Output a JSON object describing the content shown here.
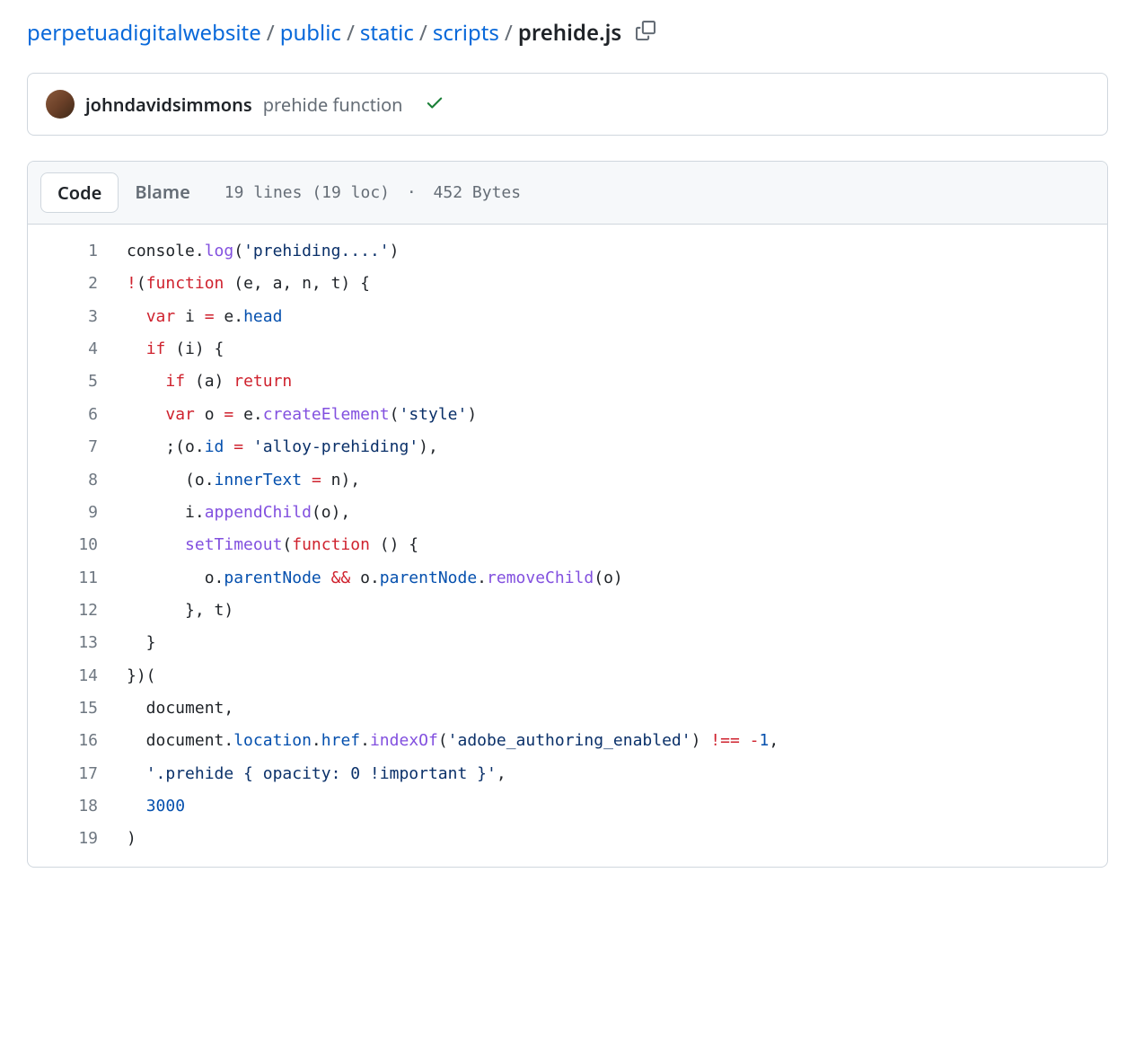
{
  "breadcrumb": {
    "parts": [
      "perpetuadigitalwebsite",
      "public",
      "static",
      "scripts"
    ],
    "current": "prehide.js",
    "sep": "/"
  },
  "commit": {
    "author": "johndavidsimmons",
    "message": "prehide function"
  },
  "tabs": {
    "code": "Code",
    "blame": "Blame"
  },
  "fileinfo": {
    "lines": "19 lines (19 loc)",
    "dot": "·",
    "size": "452 Bytes"
  },
  "line_count": 19,
  "code": {
    "tokens": [
      [
        [
          "plain",
          "console."
        ],
        [
          "fn",
          "log"
        ],
        [
          "plain",
          "("
        ],
        [
          "str",
          "'prehiding....'"
        ],
        [
          "plain",
          ")"
        ]
      ],
      [
        [
          "op",
          "!"
        ],
        [
          "plain",
          "("
        ],
        [
          "kw",
          "function"
        ],
        [
          "plain",
          " (e, a, n, t) {"
        ]
      ],
      [
        [
          "plain",
          "  "
        ],
        [
          "kw",
          "var"
        ],
        [
          "plain",
          " i "
        ],
        [
          "op",
          "="
        ],
        [
          "plain",
          " e."
        ],
        [
          "prop",
          "head"
        ]
      ],
      [
        [
          "plain",
          "  "
        ],
        [
          "kw",
          "if"
        ],
        [
          "plain",
          " (i) {"
        ]
      ],
      [
        [
          "plain",
          "    "
        ],
        [
          "kw",
          "if"
        ],
        [
          "plain",
          " (a) "
        ],
        [
          "kw",
          "return"
        ]
      ],
      [
        [
          "plain",
          "    "
        ],
        [
          "kw",
          "var"
        ],
        [
          "plain",
          " o "
        ],
        [
          "op",
          "="
        ],
        [
          "plain",
          " e."
        ],
        [
          "fn",
          "createElement"
        ],
        [
          "plain",
          "("
        ],
        [
          "str",
          "'style'"
        ],
        [
          "plain",
          ")"
        ]
      ],
      [
        [
          "plain",
          "    ;(o."
        ],
        [
          "prop",
          "id"
        ],
        [
          "plain",
          " "
        ],
        [
          "op",
          "="
        ],
        [
          "plain",
          " "
        ],
        [
          "str",
          "'alloy-prehiding'"
        ],
        [
          "plain",
          "),"
        ]
      ],
      [
        [
          "plain",
          "      (o."
        ],
        [
          "prop",
          "innerText"
        ],
        [
          "plain",
          " "
        ],
        [
          "op",
          "="
        ],
        [
          "plain",
          " n),"
        ]
      ],
      [
        [
          "plain",
          "      i."
        ],
        [
          "fn",
          "appendChild"
        ],
        [
          "plain",
          "(o),"
        ]
      ],
      [
        [
          "plain",
          "      "
        ],
        [
          "fn",
          "setTimeout"
        ],
        [
          "plain",
          "("
        ],
        [
          "kw",
          "function"
        ],
        [
          "plain",
          " () {"
        ]
      ],
      [
        [
          "plain",
          "        o."
        ],
        [
          "prop",
          "parentNode"
        ],
        [
          "plain",
          " "
        ],
        [
          "op",
          "&&"
        ],
        [
          "plain",
          " o."
        ],
        [
          "prop",
          "parentNode"
        ],
        [
          "plain",
          "."
        ],
        [
          "fn",
          "removeChild"
        ],
        [
          "plain",
          "(o)"
        ]
      ],
      [
        [
          "plain",
          "      }, t)"
        ]
      ],
      [
        [
          "plain",
          "  }"
        ]
      ],
      [
        [
          "plain",
          "})("
        ]
      ],
      [
        [
          "plain",
          "  document,"
        ]
      ],
      [
        [
          "plain",
          "  document."
        ],
        [
          "prop",
          "location"
        ],
        [
          "plain",
          "."
        ],
        [
          "prop",
          "href"
        ],
        [
          "plain",
          "."
        ],
        [
          "fn",
          "indexOf"
        ],
        [
          "plain",
          "("
        ],
        [
          "str",
          "'adobe_authoring_enabled'"
        ],
        [
          "plain",
          ") "
        ],
        [
          "op",
          "!=="
        ],
        [
          "plain",
          " "
        ],
        [
          "op",
          "-"
        ],
        [
          "num",
          "1"
        ],
        [
          "plain",
          ","
        ]
      ],
      [
        [
          "plain",
          "  "
        ],
        [
          "str",
          "'.prehide { opacity: 0 !important }'"
        ],
        [
          "plain",
          ","
        ]
      ],
      [
        [
          "plain",
          "  "
        ],
        [
          "num",
          "3000"
        ]
      ],
      [
        [
          "plain",
          ")"
        ]
      ]
    ]
  }
}
